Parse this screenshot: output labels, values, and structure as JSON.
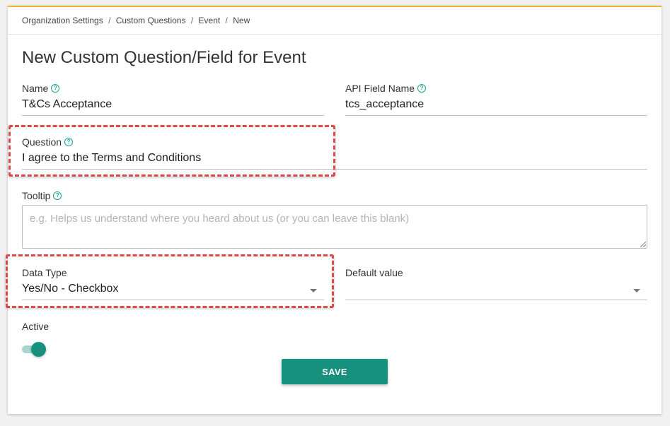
{
  "breadcrumb": {
    "items": [
      "Organization Settings",
      "Custom Questions",
      "Event",
      "New"
    ],
    "separator": "/"
  },
  "page": {
    "title": "New Custom Question/Field for Event"
  },
  "help_glyph": "?",
  "form": {
    "name": {
      "label": "Name",
      "value": "T&Cs Acceptance"
    },
    "api_field_name": {
      "label": "API Field Name",
      "value": "tcs_acceptance"
    },
    "question": {
      "label": "Question",
      "value": "I agree to the Terms and Conditions"
    },
    "tooltip": {
      "label": "Tooltip",
      "placeholder": "e.g. Helps us understand where you heard about us (or you can leave this blank)",
      "value": ""
    },
    "data_type": {
      "label": "Data Type",
      "value": "Yes/No - Checkbox"
    },
    "default_value": {
      "label": "Default value",
      "value": ""
    },
    "active": {
      "label": "Active",
      "on": true
    },
    "save_label": "SAVE"
  },
  "colors": {
    "accent": "#16917e",
    "top_border": "#f0b429",
    "highlight": "#e04848"
  },
  "icons": {
    "help": "question-circle-icon",
    "dropdown": "caret-down-icon"
  }
}
